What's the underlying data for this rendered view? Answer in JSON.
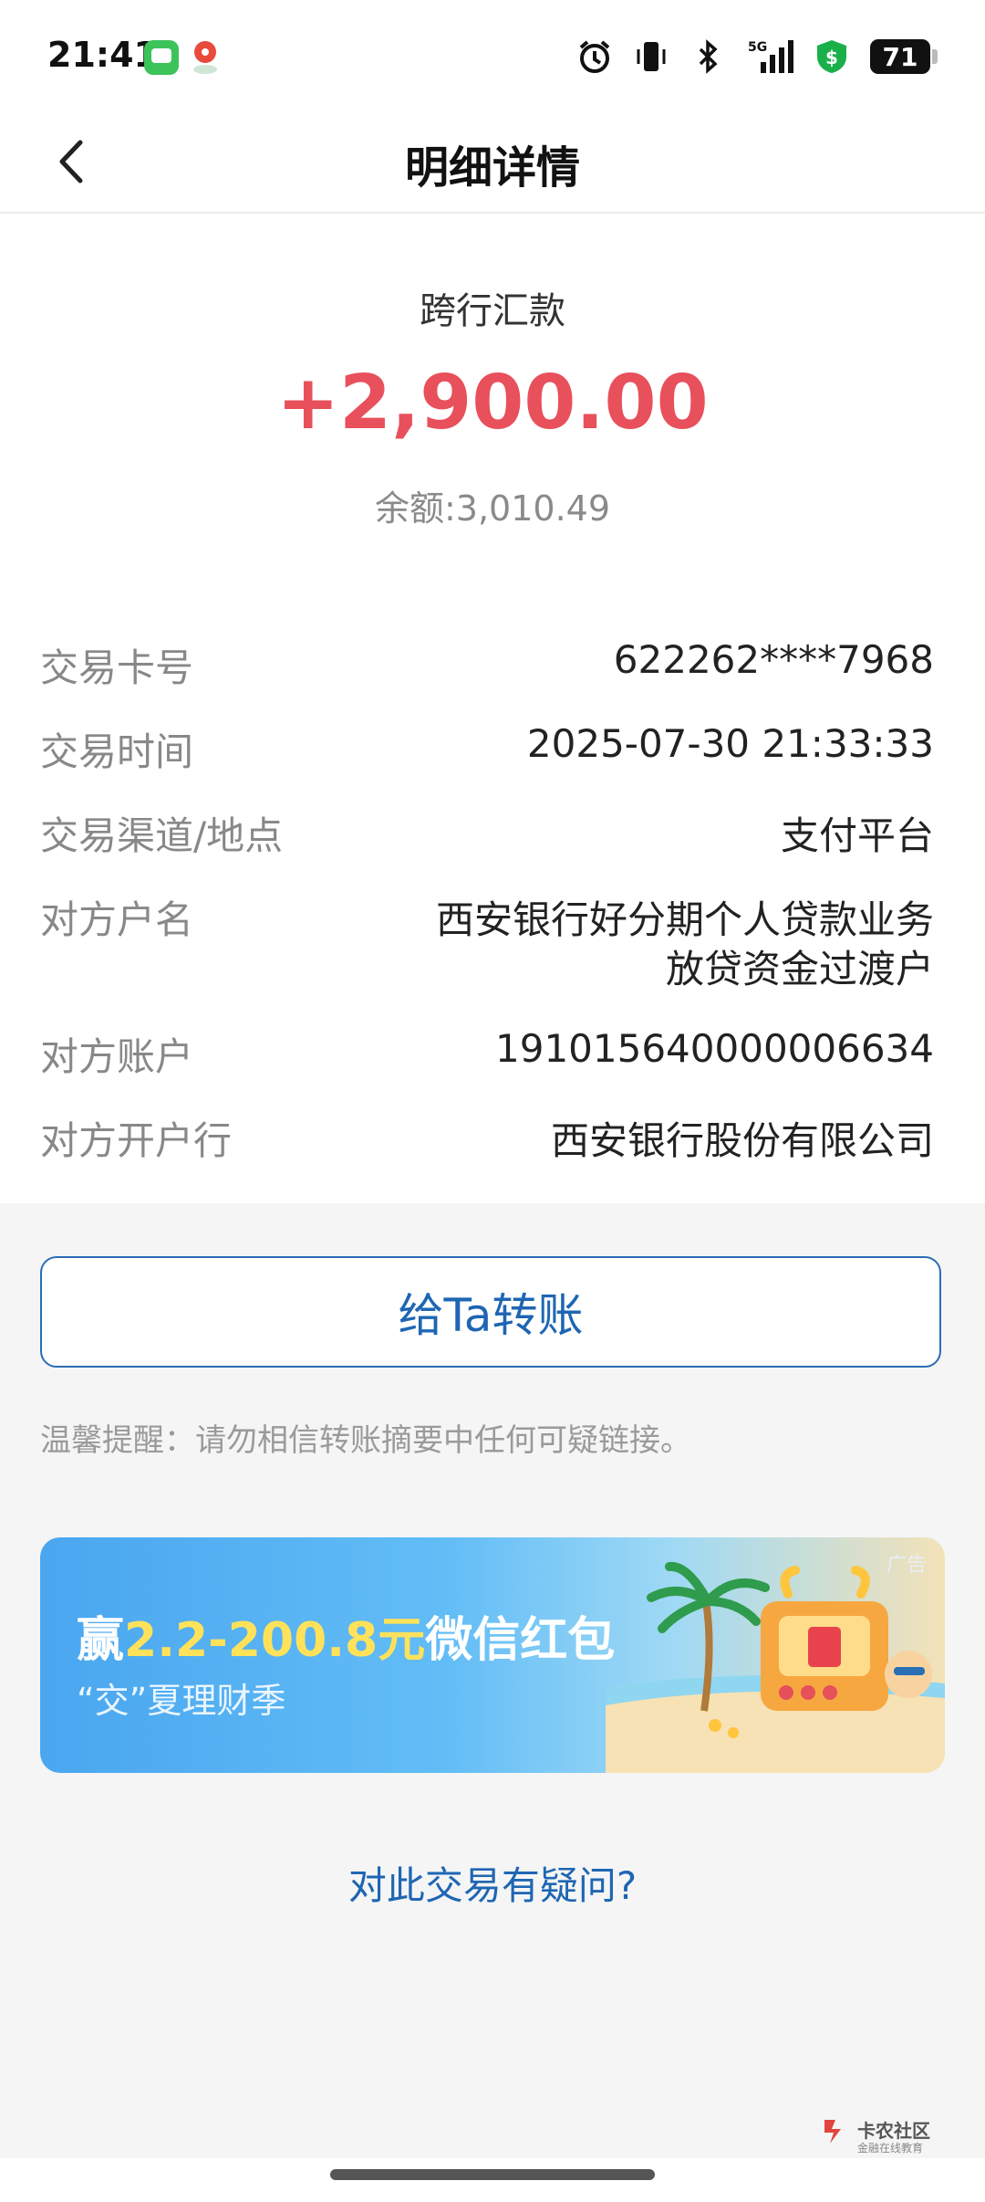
{
  "status_bar": {
    "time": "21:41",
    "battery": "71",
    "network": "5G",
    "icons": [
      "messages-app-icon",
      "map-app-icon",
      "alarm-icon",
      "vibrate-icon",
      "bluetooth-icon",
      "signal-icon",
      "shield-icon",
      "battery-icon"
    ]
  },
  "nav": {
    "title": "明细详情",
    "back_icon": "chevron-left-icon"
  },
  "transaction": {
    "type": "跨行汇款",
    "amount": "+2,900.00",
    "balance": "余额:3,010.49",
    "amount_color": "#e8505b"
  },
  "details": [
    {
      "label": "交易卡号",
      "value": "622262****7968"
    },
    {
      "label": "交易时间",
      "value": "2025-07-30 21:33:33"
    },
    {
      "label": "交易渠道/地点",
      "value": "支付平台"
    },
    {
      "label": "对方户名",
      "value": "西安银行好分期个人贷款业务",
      "value2": "放贷资金过渡户"
    },
    {
      "label": "对方账户",
      "value": "191015640000006634"
    },
    {
      "label": "对方开户行",
      "value": "西安银行股份有限公司"
    }
  ],
  "actions": {
    "transfer_label": "给Ta转账",
    "tip": "温馨提醒：请勿相信转账摘要中任何可疑链接。",
    "question": "对此交易有疑问?"
  },
  "banner": {
    "ad_tag": "广告",
    "title_prefix": "赢",
    "title_highlight": "2.2-200.8元",
    "title_suffix": "微信红包",
    "subtitle": "“交”夏理财季"
  },
  "watermark": {
    "name": "卡农社区",
    "sub": "金融在线教育"
  },
  "colors": {
    "accent_blue": "#1e66b3",
    "amount_red": "#e8505b"
  }
}
